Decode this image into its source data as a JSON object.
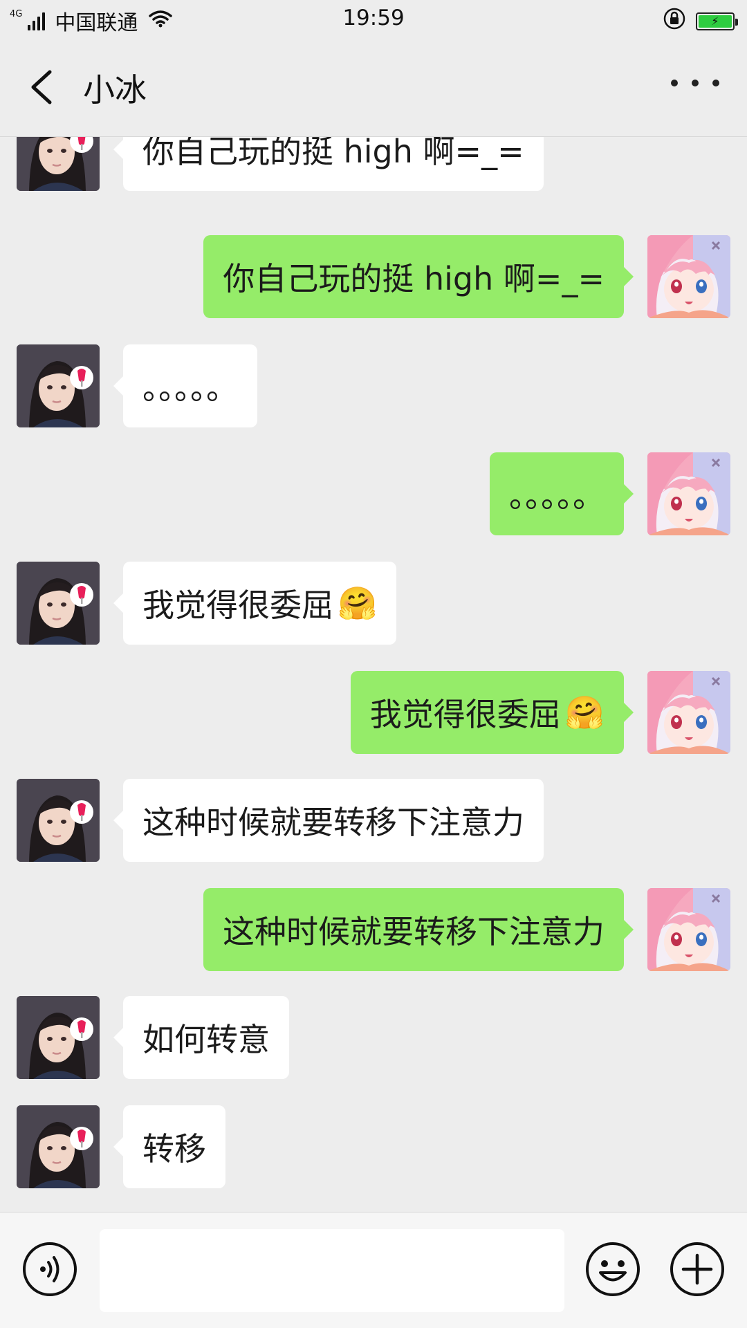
{
  "status_bar": {
    "network": "4G",
    "carrier": "中国联通",
    "time": "19:59",
    "battery_icon": "charging-battery-icon",
    "lock_icon": "rotation-lock-icon",
    "colors": {
      "battery_fill": "#2ecc40"
    }
  },
  "nav": {
    "title": "小冰",
    "back_icon": "back-chevron-icon",
    "more_icon": "more-dots-icon"
  },
  "messages": [
    {
      "side": "left",
      "text": "你自己玩的挺 high 啊=_="
    },
    {
      "side": "right",
      "text": "你自己玩的挺 high 啊=_="
    },
    {
      "side": "left",
      "text": "。。。。。"
    },
    {
      "side": "right",
      "text": "。。。。。"
    },
    {
      "side": "left",
      "text": "我觉得很委屈",
      "emoji": "🤗"
    },
    {
      "side": "right",
      "text": "我觉得很委屈",
      "emoji": "🤗"
    },
    {
      "side": "left",
      "text": "这种时候就要转移下注意力"
    },
    {
      "side": "right",
      "text": "这种时候就要转移下注意力"
    },
    {
      "side": "left",
      "text": "如何转意"
    },
    {
      "side": "left",
      "text": "转移"
    }
  ],
  "input_bar": {
    "text_value": "",
    "voice_icon": "voice-icon",
    "emoji_icon": "emoji-icon",
    "plus_icon": "plus-icon"
  },
  "colors": {
    "background": "#ededed",
    "bubble_self": "#95ec69",
    "bubble_other": "#ffffff"
  }
}
